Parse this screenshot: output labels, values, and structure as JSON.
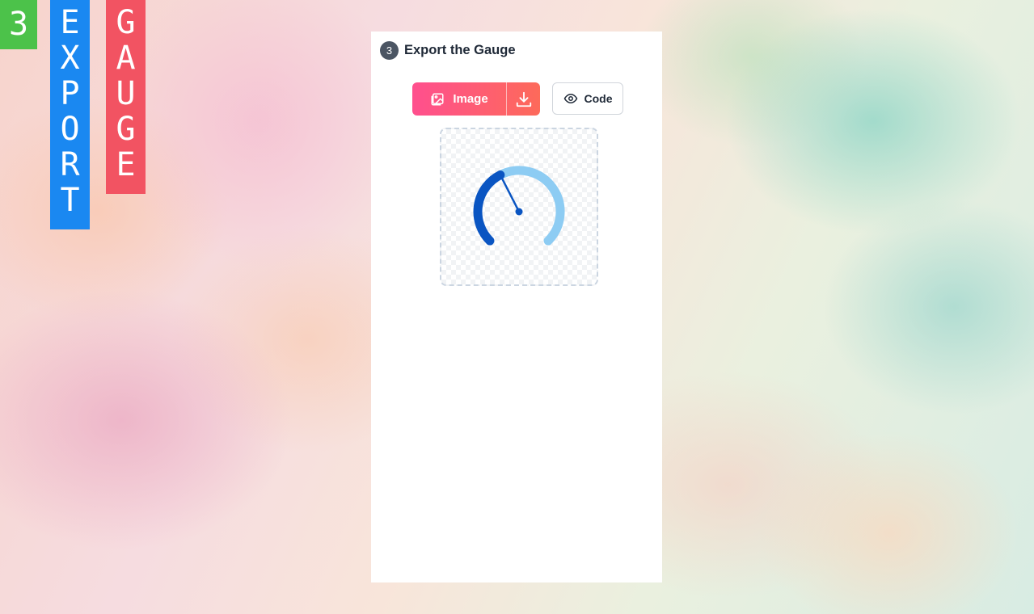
{
  "banner": {
    "step_number": "3",
    "word_export": [
      "E",
      "X",
      "P",
      "O",
      "R",
      "T"
    ],
    "word_gauge": [
      "G",
      "A",
      "U",
      "G",
      "E"
    ],
    "colors": {
      "green": "#4cc24a",
      "blue": "#1a88f1",
      "red": "#f25362"
    }
  },
  "panel": {
    "step_badge": "3",
    "title": "Export the Gauge",
    "buttons": {
      "image_label": "Image",
      "image_icon": "image-icon",
      "download_icon": "download-icon",
      "code_label": "Code",
      "code_icon": "eye-icon"
    },
    "preview": {
      "gauge": {
        "value_fraction": 0.4,
        "progress_color": "#0a55c2",
        "track_color": "#8dccf3",
        "needle_color": "#0a55c2"
      }
    }
  }
}
